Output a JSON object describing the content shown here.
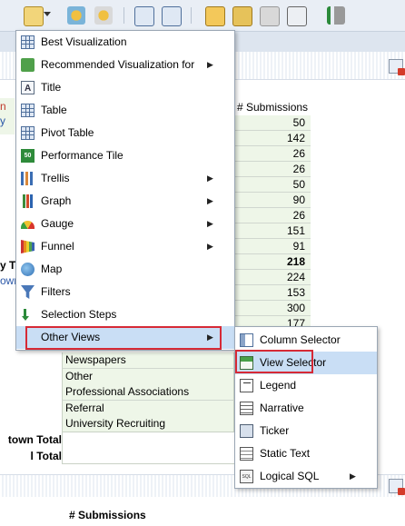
{
  "background": {
    "left_fragments": {
      "row1": "n",
      "row2": "y",
      "bold_frag": "y T",
      "link_frag": "own"
    },
    "column_header": "# Submissions",
    "submissions": [
      "50",
      "142",
      "26",
      "26",
      "50",
      "90",
      "26",
      "151",
      "91",
      "218",
      "224",
      "153",
      "300",
      "177"
    ],
    "bold_index": 9,
    "categories": [
      "Newspapers",
      "Other",
      "Professional Associations",
      "Referral",
      "University Recruiting"
    ],
    "totals": [
      "town Total",
      "l Total"
    ],
    "footer_header": "# Submissions"
  },
  "main_menu": {
    "items": [
      {
        "label": "Best Visualization",
        "icon": "table-grid-icon",
        "submenu": false
      },
      {
        "label": "Recommended Visualization for",
        "icon": "recommended-star-icon",
        "submenu": true
      },
      {
        "label": "Title",
        "icon": "title-icon",
        "submenu": false
      },
      {
        "label": "Table",
        "icon": "table-icon",
        "submenu": false
      },
      {
        "label": "Pivot Table",
        "icon": "pivot-table-icon",
        "submenu": false
      },
      {
        "label": "Performance Tile",
        "icon": "performance-tile-icon",
        "submenu": false
      },
      {
        "label": "Trellis",
        "icon": "trellis-icon",
        "submenu": true
      },
      {
        "label": "Graph",
        "icon": "graph-icon",
        "submenu": true
      },
      {
        "label": "Gauge",
        "icon": "gauge-icon",
        "submenu": true
      },
      {
        "label": "Funnel",
        "icon": "funnel-icon",
        "submenu": true
      },
      {
        "label": "Map",
        "icon": "map-icon",
        "submenu": false
      },
      {
        "label": "Filters",
        "icon": "filter-icon",
        "submenu": false
      },
      {
        "label": "Selection Steps",
        "icon": "selection-steps-icon",
        "submenu": false
      },
      {
        "label": "Other Views",
        "icon": "",
        "submenu": true
      }
    ],
    "performance_tile_icon_text": "50"
  },
  "sub_menu": {
    "items": [
      {
        "label": "Column Selector",
        "icon": "column-selector-icon",
        "submenu": false
      },
      {
        "label": "View Selector",
        "icon": "view-selector-icon",
        "submenu": false
      },
      {
        "label": "Legend",
        "icon": "legend-icon",
        "submenu": false
      },
      {
        "label": "Narrative",
        "icon": "narrative-icon",
        "submenu": false
      },
      {
        "label": "Ticker",
        "icon": "ticker-icon",
        "submenu": false
      },
      {
        "label": "Static Text",
        "icon": "static-text-icon",
        "submenu": false
      },
      {
        "label": "Logical SQL",
        "icon": "logical-sql-icon",
        "submenu": true
      }
    ],
    "sql_icon_text": "SQL"
  },
  "colors": {
    "highlight": "#c9def5",
    "annotation_red": "#d62a36",
    "cell_green": "#eef6e8"
  }
}
